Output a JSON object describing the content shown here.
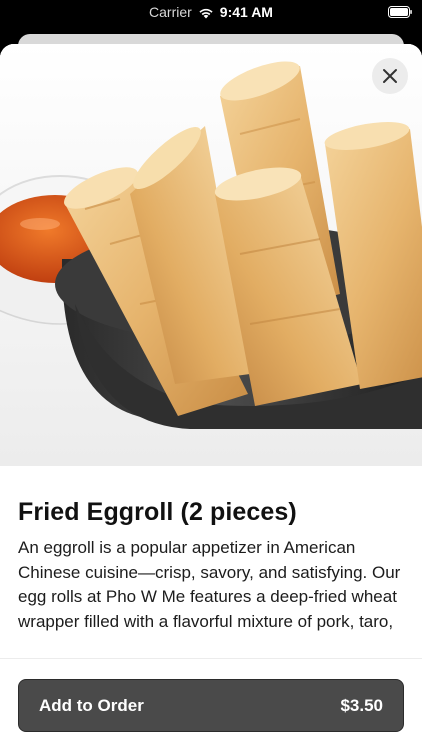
{
  "status_bar": {
    "carrier": "Carrier",
    "time": "9:41 AM"
  },
  "item": {
    "title": "Fried Eggroll (2 pieces)",
    "description": "An eggroll is a popular appetizer in American Chinese cuisine—crisp, savory, and satisfying. Our egg rolls at Pho W Me features a deep-fried wheat wrapper filled with a flavorful mixture of pork, taro, and"
  },
  "action": {
    "label": "Add to Order",
    "price": "$3.50"
  },
  "colors": {
    "button_bg": "#4a4a4a",
    "button_text": "#ffffff"
  },
  "icons": {
    "close": "close-icon",
    "wifi": "wifi-icon",
    "battery": "battery-icon"
  }
}
